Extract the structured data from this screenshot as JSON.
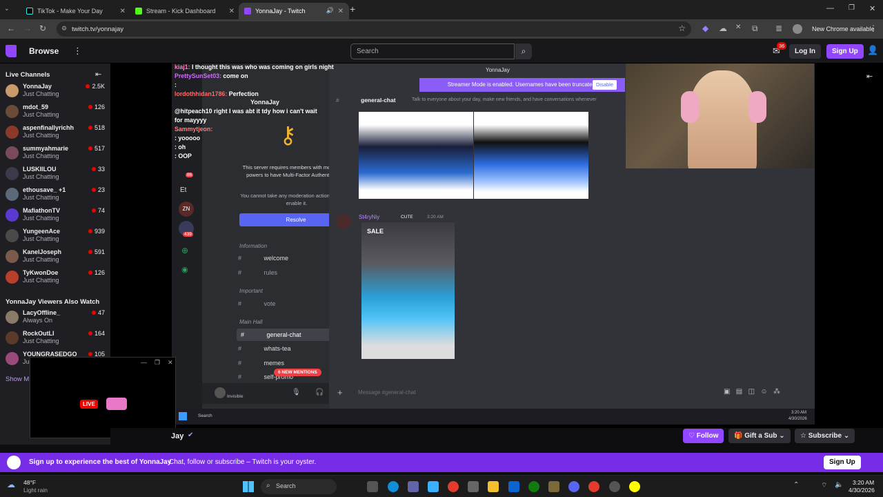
{
  "browser": {
    "tabs": [
      {
        "label": "TikTok - Make Your Day",
        "active": false
      },
      {
        "label": "Stream - Kick Dashboard",
        "active": false
      },
      {
        "label": "YonnaJay - Twitch",
        "active": true
      }
    ],
    "new_tab": "+",
    "url": "twitch.tv/yonnajay",
    "chrome_notice": "New Chrome available"
  },
  "topnav": {
    "browse": "Browse",
    "search_placeholder": "Search",
    "notif_count": "36",
    "login": "Log In",
    "signup": "Sign Up"
  },
  "sidebar": {
    "live_header": "Live Channels",
    "channels": [
      {
        "name": "YonnaJay",
        "game": "Just Chatting",
        "viewers": "2.5K",
        "color": "#c99a6a"
      },
      {
        "name": "mdot_59",
        "game": "Just Chatting",
        "viewers": "126",
        "color": "#6b4a3a"
      },
      {
        "name": "aspenfinallyrichh",
        "game": "Just Chatting",
        "viewers": "518",
        "color": "#8a3a2a"
      },
      {
        "name": "summyahmarie",
        "game": "Just Chatting",
        "viewers": "517",
        "color": "#7a4a5a"
      },
      {
        "name": "LUSKIILOU",
        "game": "Just Chatting",
        "viewers": "33",
        "color": "#3a3a4a"
      },
      {
        "name": "ethousave_ +1",
        "game": "Just Chatting",
        "viewers": "23",
        "color": "#5a6a7a"
      },
      {
        "name": "MafiathonTV",
        "game": "Just Chatting",
        "viewers": "74",
        "color": "#5b3ad1"
      },
      {
        "name": "YungeenAce",
        "game": "Just Chatting",
        "viewers": "939",
        "color": "#4a4a4a"
      },
      {
        "name": "KanelJoseph",
        "game": "Just Chatting",
        "viewers": "591",
        "color": "#7a5a4a"
      },
      {
        "name": "TyKwonDoe",
        "game": "Just Chatting",
        "viewers": "126",
        "color": "#b8402a"
      }
    ],
    "also_watch_header": "YonnaJay Viewers Also Watch",
    "also_watch": [
      {
        "name": "LacyOffline_",
        "game": "Always On",
        "viewers": "47",
        "color": "#8a7a6a"
      },
      {
        "name": "RockOutLI",
        "game": "Just Chatting",
        "viewers": "164",
        "color": "#5a3a2a"
      },
      {
        "name": "YOUNGRASEDGO",
        "game": "Ju",
        "viewers": "105",
        "color": "#9a4a7a"
      }
    ],
    "show_more": "Show M"
  },
  "stream": {
    "chat_lines": [
      {
        "user": "kiaj1:",
        "msg": "I thought this was who was coming on girls night",
        "color": "#ff7fbf"
      },
      {
        "user": "PrettySunSet03:",
        "msg": "come on",
        "color": "#d36bff"
      },
      {
        "user": "",
        "msg": ":",
        "color": "#ff5bbb"
      },
      {
        "user": "lordothhidan1786:",
        "msg": "Perfection",
        "color": "#ff6b6b"
      },
      {
        "user": "",
        "msg": "@hitpeach10 right I was abt it tdy how i can't wait",
        "color": "#ff4f4f"
      },
      {
        "user": "",
        "msg": "for mayyyy",
        "color": "#fff"
      },
      {
        "user": "Sammytjeon:",
        "msg": "",
        "color": "#ff7f7f"
      },
      {
        "user": "",
        "msg": ": yooooo",
        "color": "#ff7f7f"
      },
      {
        "user": "",
        "msg": ": oh",
        "color": "#ff7f7f"
      },
      {
        "user": "",
        "msg": ": OOP",
        "color": "#ff7f7f"
      }
    ],
    "discord_user": "YonnaJay",
    "banner_text": "Streamer Mode is enabled. Usernames have been truncated.",
    "banner_button": "Disable",
    "server_name": "YonnaJay",
    "mfa_title": "This server requires members with moderation powers to have Multi-Factor Authentication.",
    "mfa_sub": "You cannot take any moderation actions until you enable it.",
    "resolve": "Resolve",
    "categories": [
      "Information",
      "Important",
      "Main Hall"
    ],
    "channels": [
      "welcome",
      "rules",
      "vote",
      "general-chat",
      "whats-tea",
      "memes",
      "self-promo"
    ],
    "mentions": "6 NEW MENTIONS",
    "channel_header": "general-chat",
    "channel_topic": "Talk to everyone about your day, make new friends, and have conversations whenever",
    "post_user": "St4ryNiy",
    "post_tag": "CUTE",
    "post_time": "3:20 AM",
    "sale_tag": "SALE",
    "message_placeholder": "Message #general-chat",
    "inner_search": "Search",
    "inner_time": "3:20 AM",
    "inner_date": "4/30/2026",
    "rail_badges": [
      "86",
      "439"
    ],
    "rail_letters": [
      "Et",
      "ZN"
    ],
    "user_status": "Invisible"
  },
  "mini": {
    "live": "LIVE"
  },
  "infobar": {
    "name_fragment": "Jay",
    "follow": "Follow",
    "gift": "Gift a Sub",
    "subscribe": "Subscribe"
  },
  "cta": {
    "title": "Sign up to experience the best of YonnaJay",
    "sub": "Chat, follow or subscribe – Twitch is your oyster.",
    "button": "Sign Up"
  },
  "taskbar": {
    "weather_temp": "48°F",
    "weather_desc": "Light rain",
    "search": "Search",
    "time": "3:20 AM",
    "date": "4/30/2026"
  }
}
